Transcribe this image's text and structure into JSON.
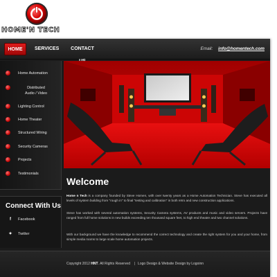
{
  "brand": {
    "logo_text": "HOME'N TECH",
    "accent": "#d40000",
    "icon": "power-button-icon"
  },
  "nav": {
    "items": [
      {
        "label": "HOME",
        "active": true
      },
      {
        "label": "SERVICES",
        "active": false
      },
      {
        "label": "CONTACT US",
        "active": false
      }
    ],
    "email_label": "Email:",
    "email": "info@homentech.com"
  },
  "sidebar": {
    "items": [
      {
        "label": "Home Automation"
      },
      {
        "label": "Distributed Audio / Video",
        "line1": "Distributed",
        "line2": "Audio / Video"
      },
      {
        "label": "Lighting Control"
      },
      {
        "label": "Home Theater"
      },
      {
        "label": "Structured Wiring"
      },
      {
        "label": "Security Cameras"
      },
      {
        "label": "Projects"
      },
      {
        "label": "Testimonials"
      }
    ],
    "bullet_icon": "red-bullet-icon"
  },
  "connect": {
    "title": "Connect With Us",
    "links": [
      {
        "label": "Facebook",
        "icon": "facebook-icon"
      },
      {
        "label": "Twitter",
        "icon": "twitter-icon"
      }
    ]
  },
  "main": {
    "title": "Welcome",
    "para1_lead": "Home n Tech",
    "para1_rest": " is a company founded by Steve Homen, with over twenty years as a Home Automation Technician. Steve has executed all levels of system building from \"rough in\" to final \"testing and calibration\" in both retro and new construction applications.",
    "para2": "Steve has worked with several automation systems, Security Camera systems, AV products and music and video servers. Projects have ranged from full home solutions in new builds exceeding ten thousand square feet, to high end theatre and two channel solutions.",
    "para3": "With our background we have the knowledge to recommend the correct technology and create the right system for you and your home, from simple media rooms to large scale home automation projects."
  },
  "footer": {
    "copyright_pre": "Copyright 2012 ",
    "copyright_brand": "HNT",
    "copyright_post": ". All Rights Reserved",
    "separator": "|",
    "credit": "Logo Design & Website Design by Logoinn"
  }
}
